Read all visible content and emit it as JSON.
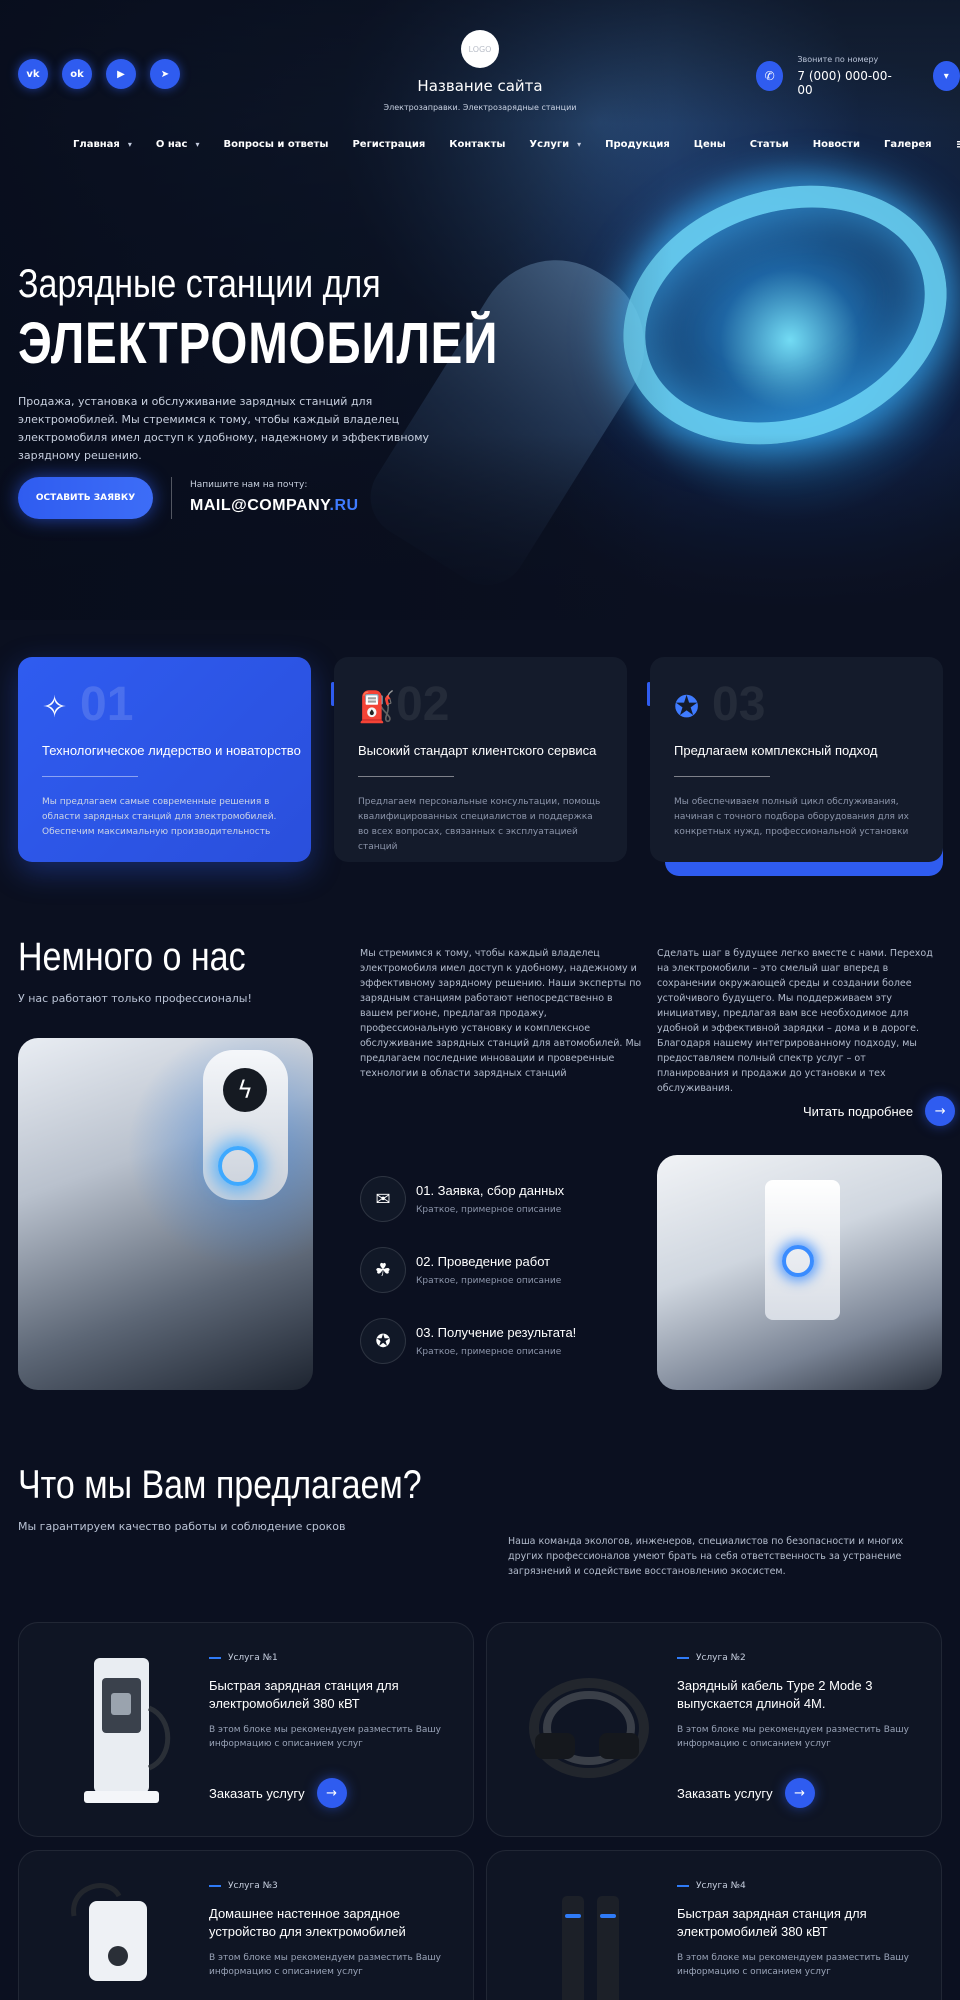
{
  "header": {
    "socials": [
      {
        "icon": "vk-icon",
        "glyph": "vk"
      },
      {
        "icon": "odnoklassniki-icon",
        "glyph": "ok"
      },
      {
        "icon": "youtube-icon",
        "glyph": "▶"
      },
      {
        "icon": "telegram-icon",
        "glyph": "➤"
      }
    ],
    "logo_text": "LOGO",
    "site_name": "Название сайта",
    "site_subtitle": "Электрозаправки. Электрозарядные станции",
    "phone_label": "Звоните по номеру",
    "phone_number": "7 (000) 000-00-00"
  },
  "nav": {
    "items": [
      "Главная",
      "О нас",
      "Вопросы и ответы",
      "Регистрация",
      "Контакты",
      "Услуги",
      "Продукция",
      "Цены",
      "Статьи",
      "Новости",
      "Галерея"
    ]
  },
  "hero": {
    "title_line1": "Зарядные станции для",
    "title_line2": "ЭЛЕКТРОМОБИЛЕЙ",
    "description": "Продажа, установка и обслуживание зарядных станций для электромобилей. Мы стремимся к тому, чтобы каждый владелец электромобиля имел доступ к удобному, надежному и эффективному зарядному решению.",
    "cta_label": "ОСТАВИТЬ ЗАЯВКУ",
    "mail_label": "Напишите нам на почту:",
    "mail_main": "MAIL@COMPANY",
    "mail_tld": ".RU"
  },
  "features": [
    {
      "num": "01",
      "title": "Технологическое лидерство и новаторство",
      "text": "Мы предлагаем самые современные решения в области зарядных станций для электромобилей. Обеспечим максимальную производительность"
    },
    {
      "num": "02",
      "title": "Высокий стандарт клиентского сервиса",
      "text": "Предлагаем персональные консультации, помощь квалифицированных специалистов и поддержка во всех вопросах, связанных с эксплуатацией станций"
    },
    {
      "num": "03",
      "title": "Предлагаем комплексный подход",
      "text": "Мы обеспечиваем полный цикл обслуживания, начиная с точного подбора оборудования для их конкретных нужд, профессиональной установки"
    }
  ],
  "about": {
    "title": "Немного о нас",
    "subtitle": "У нас работают только профессионалы!",
    "col1": "Мы стремимся к тому, чтобы каждый владелец электромобиля имел доступ к удобному, надежному и эффективному зарядному решению. Наши эксперты по зарядным станциям работают непосредственно в вашем регионе, предлагая продажу, профессиональную установку и комплексное обслуживание зарядных станций для автомобилей. Мы предлагаем последние инновации и проверенные технологии в области зарядных станций",
    "col2": "Сделать шаг в будущее легко вместе с нами. Переход на электромобили – это смелый шаг вперед в сохранении окружающей среды и создании более устойчивого будущего. Мы поддерживаем эту инициативу, предлагая вам все необходимое для удобной и эффективной зарядки – дома и в дороге. Благодаря нашему интегрированному подходу, мы предоставляем полный спектр услуг – от планирования и продажи до установки и тех обслуживания.",
    "readmore": "Читать подробнее",
    "steps": [
      {
        "title": "01. Заявка, сбор данных",
        "desc": "Краткое, примерное описание"
      },
      {
        "title": "02. Проведение работ",
        "desc": "Краткое, примерное описание"
      },
      {
        "title": "03. Получение результата!",
        "desc": "Краткое, примерное описание"
      }
    ]
  },
  "services": {
    "title": "Что мы Вам предлагаем?",
    "subtitle": "Мы гарантируем качество работы и соблюдение сроков",
    "description": "Наша команда экологов, инженеров, специалистов по безопасности и многих других профессионалов умеют брать на себя ответственность за устранение загрязнений и содействие восстановлению экосистем.",
    "order_label": "Заказать услугу",
    "items": [
      {
        "tag": "Услуга №1",
        "title": "Быстрая зарядная станция для электромобилей 380 кВТ",
        "text": "В этом блоке мы рекомендуем разместить Вашу информацию с описанием услуг"
      },
      {
        "tag": "Услуга №2",
        "title": "Зарядный кабель Type 2 Mode 3 выпускается длиной 4М.",
        "text": "В этом блоке мы рекомендуем разместить Вашу информацию с описанием услуг"
      },
      {
        "tag": "Услуга №3",
        "title": "Домашнее настенное зарядное устройство для электромобилей",
        "text": "В этом блоке мы рекомендуем разместить Вашу информацию с описанием услуг"
      },
      {
        "tag": "Услуга №4",
        "title": "Быстрая зарядная станция для электромобилей 380 кВТ",
        "text": "В этом блоке мы рекомендуем разместить Вашу информацию с описанием услуг"
      }
    ]
  },
  "colors": {
    "accent": "#2f5cf0",
    "background": "#0b1020",
    "card": "#141b2b"
  }
}
